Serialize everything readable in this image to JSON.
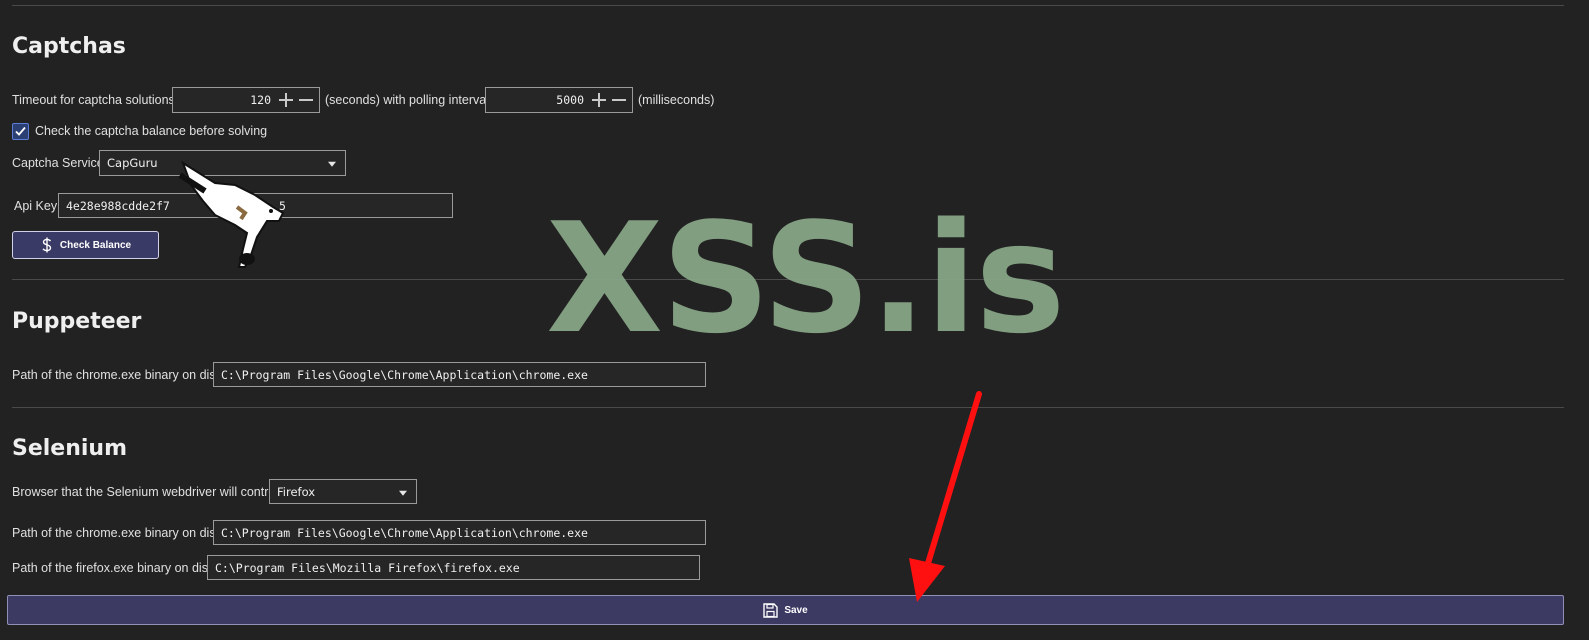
{
  "captchas": {
    "title": "Captchas",
    "timeout_label": "Timeout for captcha solutions",
    "timeout_value": "120",
    "seconds_label": "(seconds) with polling interval",
    "polling_value": "5000",
    "milliseconds_label": "(milliseconds)",
    "check_balance_label": "Check the captcha balance before solving",
    "check_balance_checked": true,
    "service_label": "Captcha Service",
    "service_value": "CapGuru",
    "api_key_label": "Api Key",
    "api_key_value": "4e28e988cdde2f7",
    "api_key_suffix": "5",
    "check_balance_button": "Check Balance"
  },
  "puppeteer": {
    "title": "Puppeteer",
    "chrome_path_label": "Path of the chrome.exe binary on disk",
    "chrome_path_value": "C:\\Program Files\\Google\\Chrome\\Application\\chrome.exe"
  },
  "selenium": {
    "title": "Selenium",
    "browser_label": "Browser that the Selenium webdriver will control",
    "browser_value": "Firefox",
    "chrome_path_label": "Path of the chrome.exe binary on disk",
    "chrome_path_value": "C:\\Program Files\\Google\\Chrome\\Application\\chrome.exe",
    "firefox_path_label": "Path of the firefox.exe binary on disk",
    "firefox_path_value": "C:\\Program Files\\Mozilla Firefox\\firefox.exe"
  },
  "save_label": "Save",
  "watermark": "XSS.is",
  "colors": {
    "background": "#222222",
    "button": "#3a3a66",
    "accent_check": "#2c3f73",
    "watermark": "#8aa98a",
    "arrow": "#ff1010"
  },
  "icons": {
    "check_balance": "dollar-icon",
    "save": "floppy-disk-icon",
    "checkbox": "checkmark-icon"
  }
}
